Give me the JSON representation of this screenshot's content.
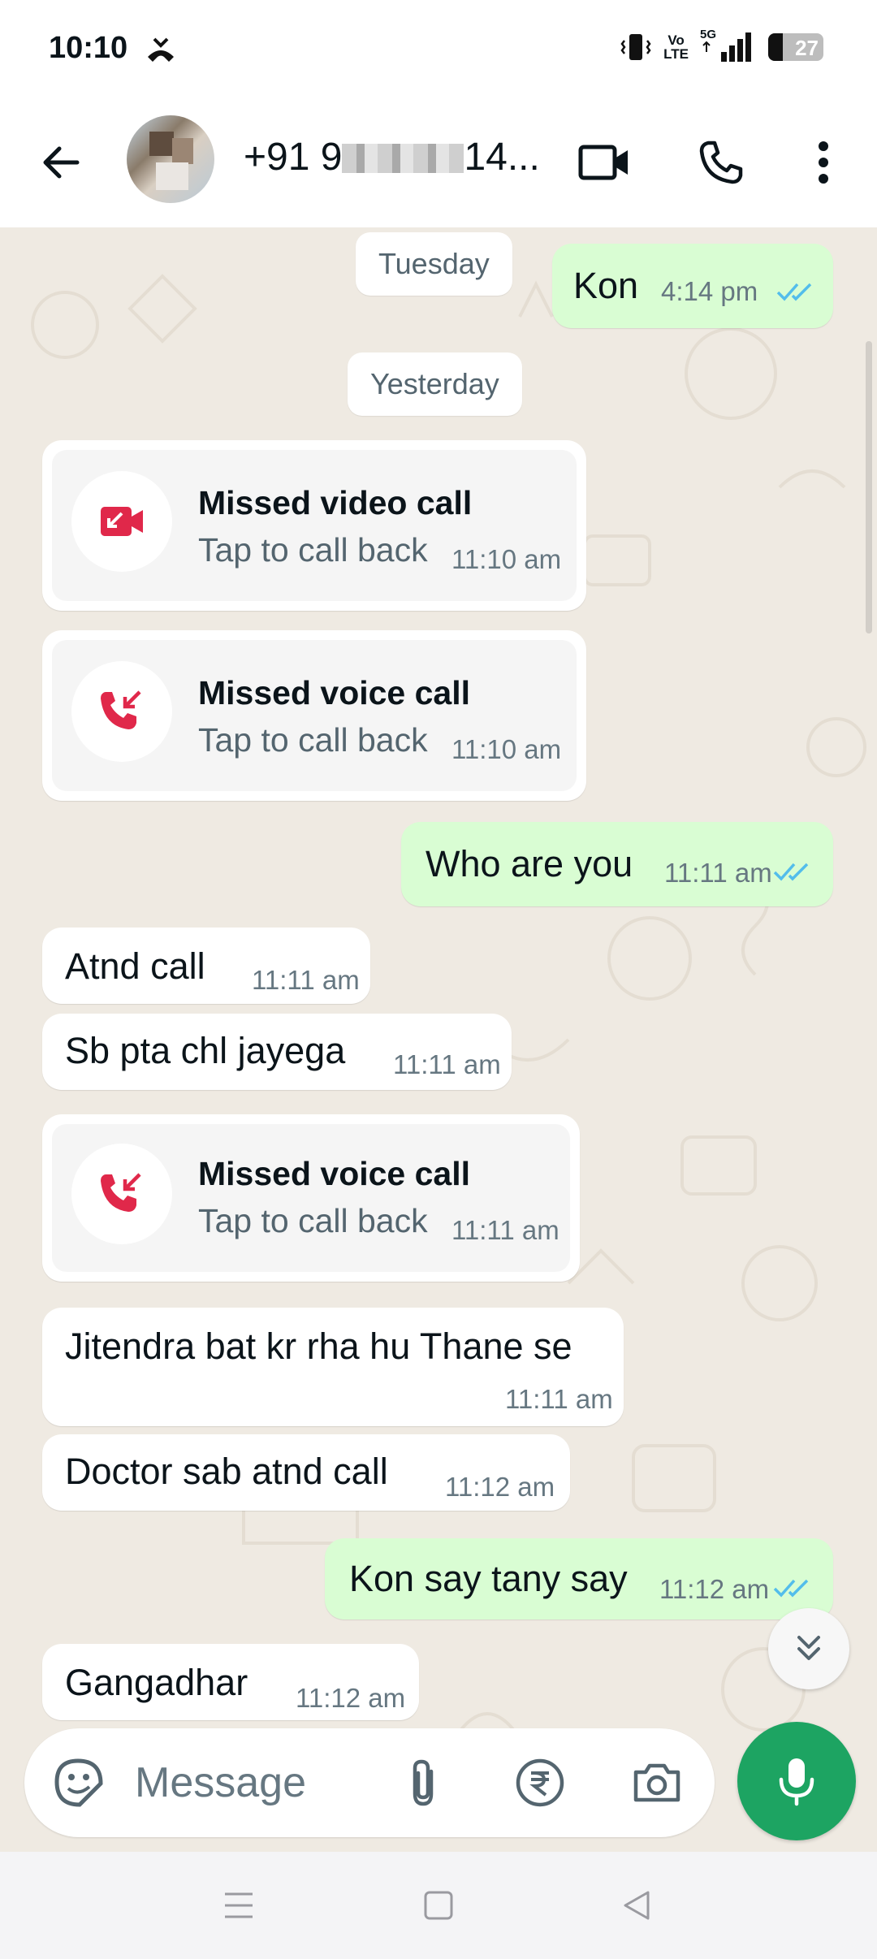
{
  "status_bar": {
    "time": "10:10",
    "network_label_top": "Vo",
    "network_label_bottom": "LTE",
    "network_5g": "5G",
    "battery": "27",
    "battery_fraction": 0.27
  },
  "header": {
    "contact_prefix": "+91 9",
    "contact_suffix": "14..."
  },
  "dates": {
    "tuesday": "Tuesday",
    "yesterday": "Yesterday"
  },
  "messages": {
    "m1": {
      "text": "Kon",
      "time": "4:14 pm"
    },
    "call1": {
      "title": "Missed video call",
      "subtitle": "Tap to call back",
      "time": "11:10 am"
    },
    "call2": {
      "title": "Missed voice call",
      "subtitle": "Tap to call back",
      "time": "11:10 am"
    },
    "m2": {
      "text": "Who are you",
      "time": "11:11 am"
    },
    "m3": {
      "text": "Atnd call",
      "time": "11:11 am"
    },
    "m4": {
      "text": "Sb pta chl jayega",
      "time": "11:11 am"
    },
    "call3": {
      "title": "Missed voice call",
      "subtitle": "Tap to call back",
      "time": "11:11 am"
    },
    "m5": {
      "text": "Jitendra bat kr rha hu Thane se",
      "time": "11:11 am"
    },
    "m6": {
      "text": "Doctor sab atnd call",
      "time": "11:12 am"
    },
    "m7": {
      "text": "Kon say tany say",
      "time": "11:12 am"
    },
    "m8": {
      "text": "Gangadhar",
      "time": "11:12 am"
    }
  },
  "composer": {
    "placeholder": "Message"
  },
  "colors": {
    "outgoing_bubble": "#d9fdd3",
    "incoming_bubble": "#ffffff",
    "chat_background": "#efeae2",
    "missed_call_red": "#e0284a",
    "read_tick_blue": "#53bdeb",
    "accent_green": "#1da462"
  },
  "icons": {
    "back": "arrow-left-icon",
    "video": "video-camera-icon",
    "phone": "phone-icon",
    "menu": "more-vertical-icon",
    "missed_video": "missed-video-call-icon",
    "missed_voice": "missed-voice-call-icon",
    "scroll_down": "double-chevron-down-icon",
    "sticker": "sticker-icon",
    "attach": "paperclip-icon",
    "payment": "rupee-icon",
    "camera": "camera-icon",
    "mic": "microphone-icon"
  }
}
